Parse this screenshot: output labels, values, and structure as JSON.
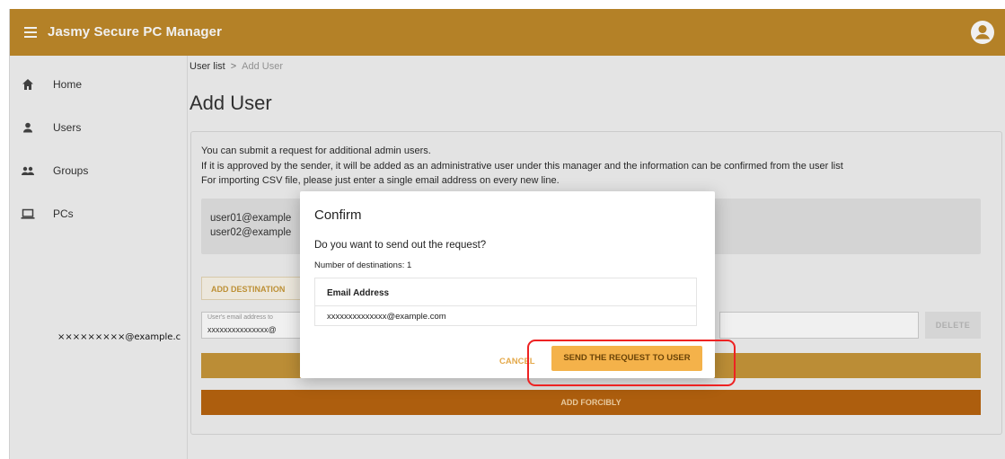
{
  "app": {
    "title": "Jasmy Secure PC Manager"
  },
  "sidebar": {
    "items": [
      {
        "label": "Home",
        "icon": "home-icon"
      },
      {
        "label": "Users",
        "icon": "user-icon"
      },
      {
        "label": "Groups",
        "icon": "group-icon"
      },
      {
        "label": "PCs",
        "icon": "laptop-icon"
      }
    ],
    "annotation_email": "×××××××××@example.c"
  },
  "breadcrumb": {
    "parent": "User list",
    "separator": ">",
    "current": "Add User"
  },
  "page": {
    "title": "Add User"
  },
  "description": [
    "You can submit a request for additional admin users.",
    "If it is approved by the sender, it will be added as an administrative user under this manager and the information can be confirmed from the user list",
    "For importing CSV file, please just enter a single email address on every new line."
  ],
  "email_textarea": {
    "lines": [
      "user01@example",
      "user02@example"
    ]
  },
  "form": {
    "add_destination_label": "ADD DESTINATION",
    "email_field_label": "User's email address to",
    "email_field_value": "xxxxxxxxxxxxxxx@",
    "delete_label": "DELETE",
    "add_forcibly_label": "ADD FORCIBLY"
  },
  "dialog": {
    "title": "Confirm",
    "question": "Do you want to send out the request?",
    "count_text": "Number of destinations: 1",
    "table_header": "Email Address",
    "rows": [
      "xxxxxxxxxxxxxx@example.com"
    ],
    "cancel_label": "CANCEL",
    "confirm_label": "SEND THE REQUEST TO USER"
  },
  "colors": {
    "appbar": "#c08a2a",
    "primary_button": "#f4b24a",
    "force_button": "#b8640f",
    "highlight": "#e22222"
  }
}
